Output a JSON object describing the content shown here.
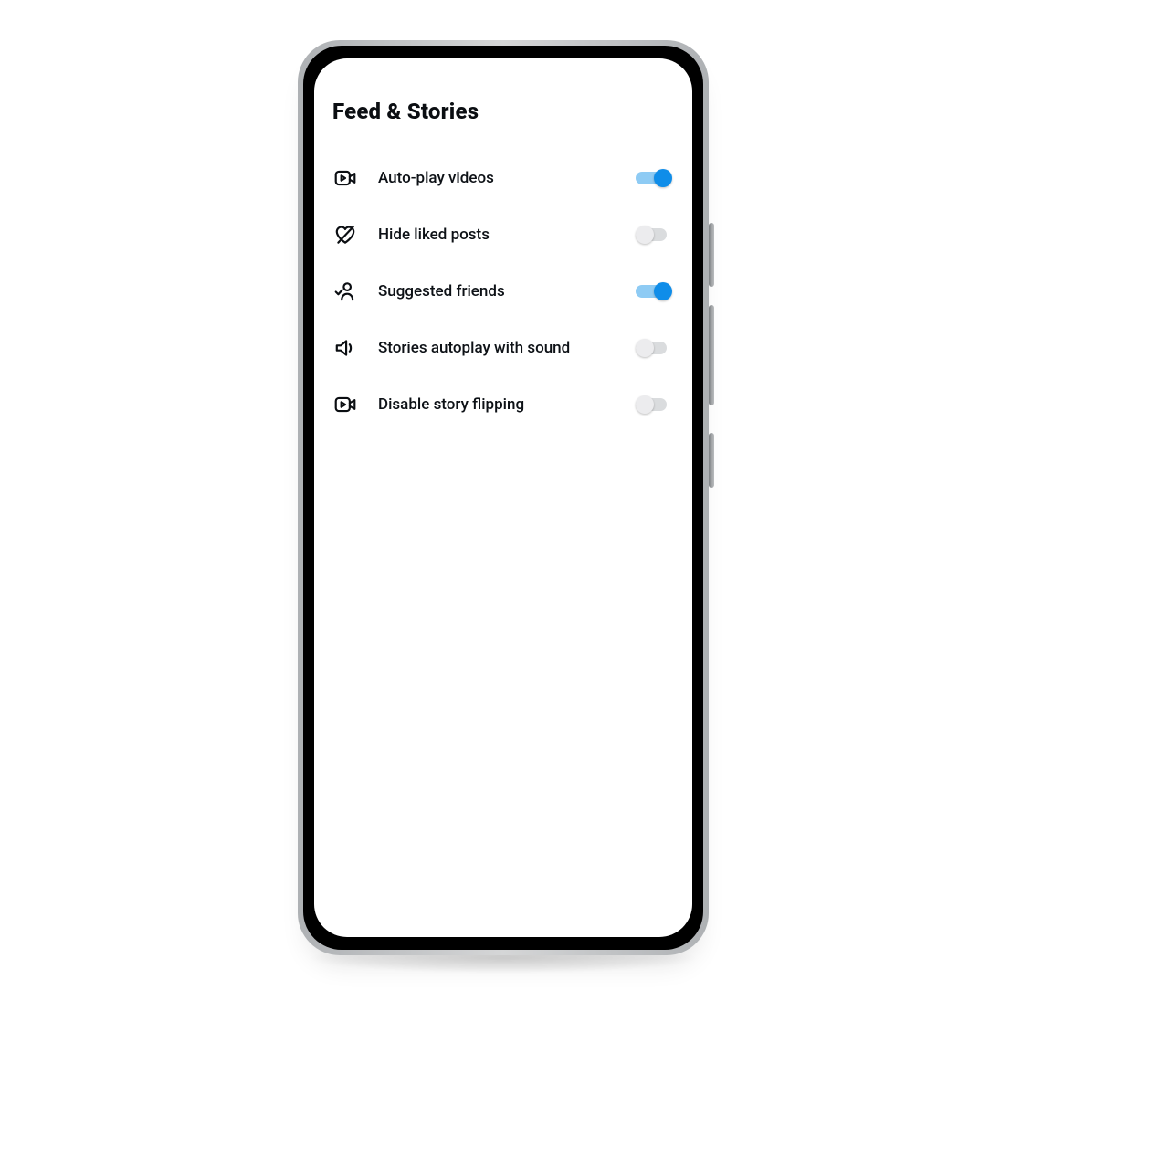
{
  "colors": {
    "toggle_on": "#0f8de9",
    "toggle_on_track": "#8ecbf4"
  },
  "page": {
    "title": "Feed & Stories"
  },
  "settings": [
    {
      "icon": "video-play-icon",
      "label": "Auto-play videos",
      "on": true
    },
    {
      "icon": "heart-off-icon",
      "label": "Hide liked posts",
      "on": false
    },
    {
      "icon": "person-check-icon",
      "label": "Suggested friends",
      "on": true
    },
    {
      "icon": "speaker-icon",
      "label": "Stories autoplay with sound",
      "on": false
    },
    {
      "icon": "video-play-icon",
      "label": "Disable story flipping",
      "on": false
    }
  ]
}
